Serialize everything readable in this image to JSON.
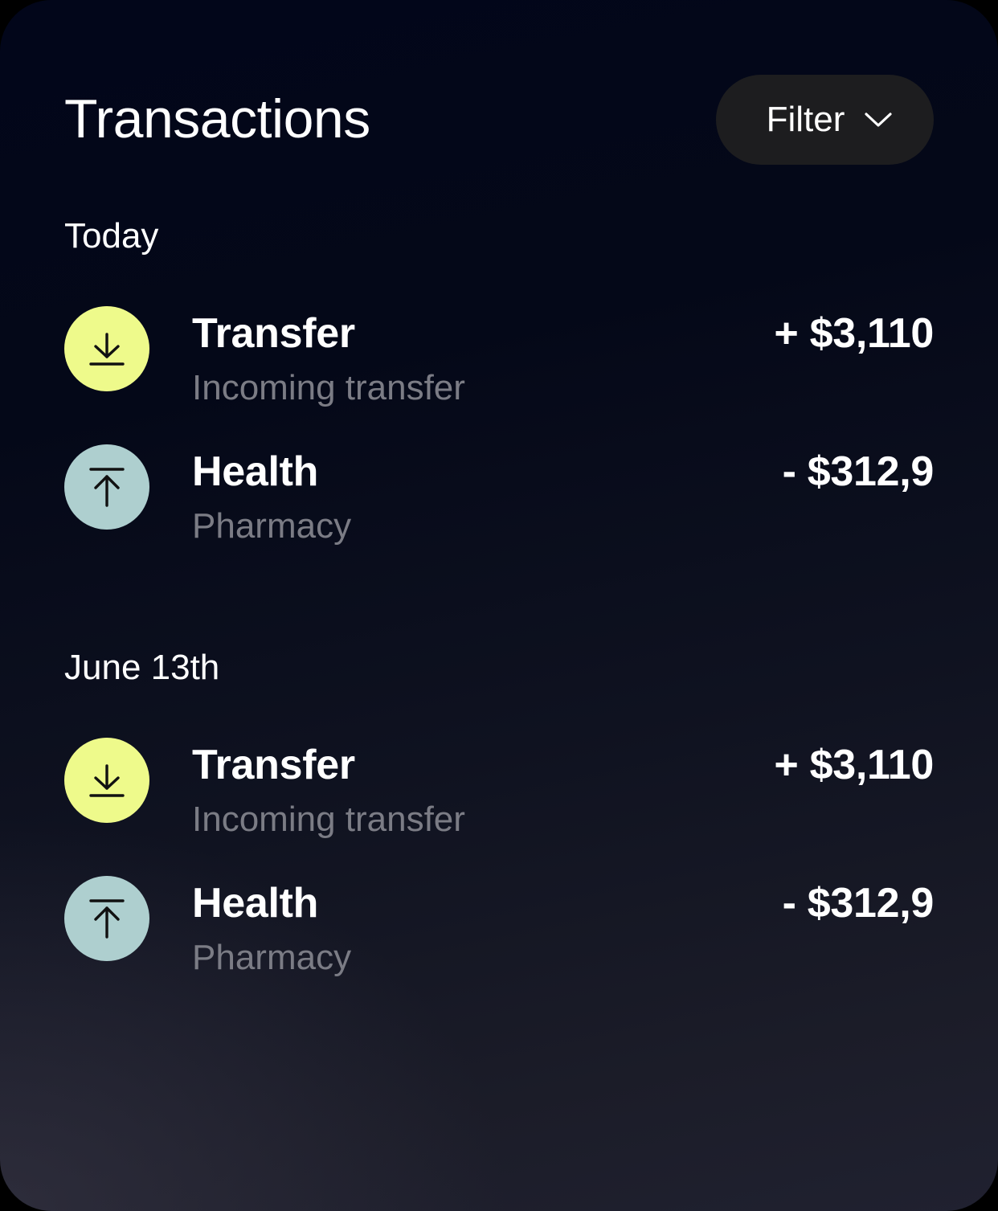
{
  "header": {
    "title": "Transactions",
    "filter_label": "Filter",
    "filter_icon": "chevron-down-icon"
  },
  "colors": {
    "incoming_icon_bg": "#eefa8b",
    "outgoing_icon_bg": "#aecfcf",
    "subtitle_text": "#7b7c85",
    "filter_bg": "#1d1d1f"
  },
  "sections": [
    {
      "label": "Today",
      "transactions": [
        {
          "title": "Transfer",
          "subtitle": "Incoming transfer",
          "amount": "+ $3,110",
          "icon": "arrow-down-to-line-icon",
          "direction": "incoming"
        },
        {
          "title": "Health",
          "subtitle": "Pharmacy",
          "amount": "- $312,9",
          "icon": "arrow-up-from-line-icon",
          "direction": "outgoing"
        }
      ]
    },
    {
      "label": "June 13th",
      "transactions": [
        {
          "title": "Transfer",
          "subtitle": "Incoming transfer",
          "amount": "+ $3,110",
          "icon": "arrow-down-to-line-icon",
          "direction": "incoming"
        },
        {
          "title": "Health",
          "subtitle": "Pharmacy",
          "amount": "- $312,9",
          "icon": "arrow-up-from-line-icon",
          "direction": "outgoing"
        }
      ]
    }
  ]
}
